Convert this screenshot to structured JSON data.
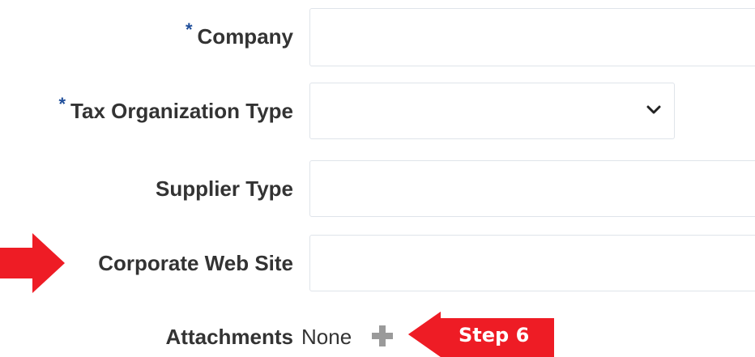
{
  "form": {
    "required_marker": "*",
    "fields": {
      "company": {
        "label": "Company",
        "value": ""
      },
      "tax_org_type": {
        "label": "Tax Organization Type",
        "value": ""
      },
      "supplier_type": {
        "label": "Supplier Type",
        "value": ""
      },
      "corporate_web_site": {
        "label": "Corporate Web Site",
        "value": ""
      }
    },
    "attachments": {
      "label": "Attachments",
      "value": "None"
    }
  },
  "annotation": {
    "callout_text": "Step 6",
    "color": "#ee1c25"
  },
  "icons": {
    "dropdown": "chevron-down-icon",
    "add": "plus-icon",
    "pointer": "arrow-right-icon"
  },
  "colors": {
    "label": "#333333",
    "required": "#1f4e9a",
    "field_border": "#dfe4ea",
    "plus": "#9a9a9a"
  }
}
